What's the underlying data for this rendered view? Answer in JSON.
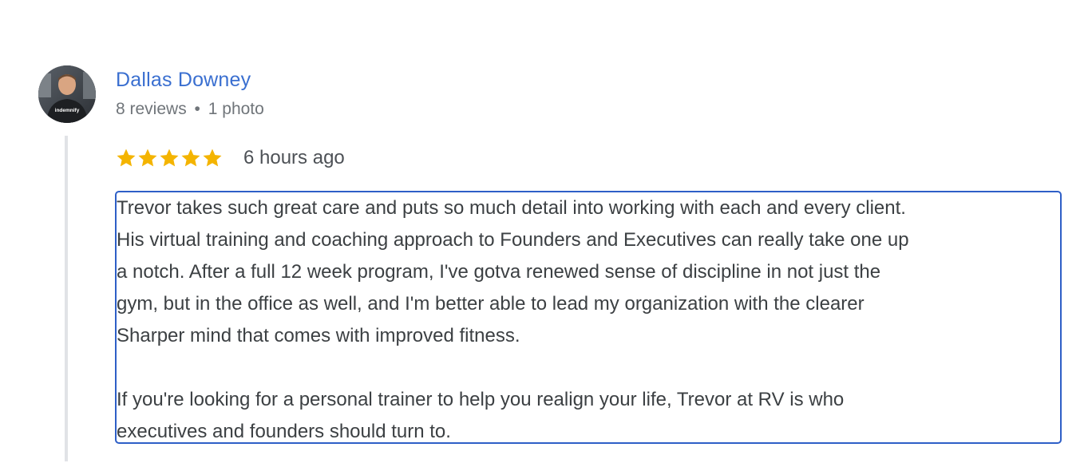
{
  "author": {
    "name": "Dallas Downey",
    "reviews": "8 reviews",
    "separator": "•",
    "photos": "1 photo",
    "avatar_shirt_text": "indemnify"
  },
  "rating": {
    "stars": 5,
    "max": 5,
    "star_color": "#f4b400",
    "time": "6 hours ago"
  },
  "review": {
    "text": "Trevor takes such great care and puts so much detail into working with each and every client.\nHis virtual training and coaching approach to Founders and Executives can really take one up\na notch. After a full 12 week program, I've gotva renewed sense of discipline in not just the\ngym, but in the office as well, and I'm better able to lead my organization with the clearer\nSharper mind that comes with improved fitness.\n\nIf you're looking for a personal trainer to help you realign your life, Trevor at RV is who\nexecutives and founders should turn to."
  },
  "colors": {
    "link": "#3a6fd0",
    "meta": "#70757a",
    "text": "#3c4043",
    "selection_border": "#2e5fc7"
  }
}
